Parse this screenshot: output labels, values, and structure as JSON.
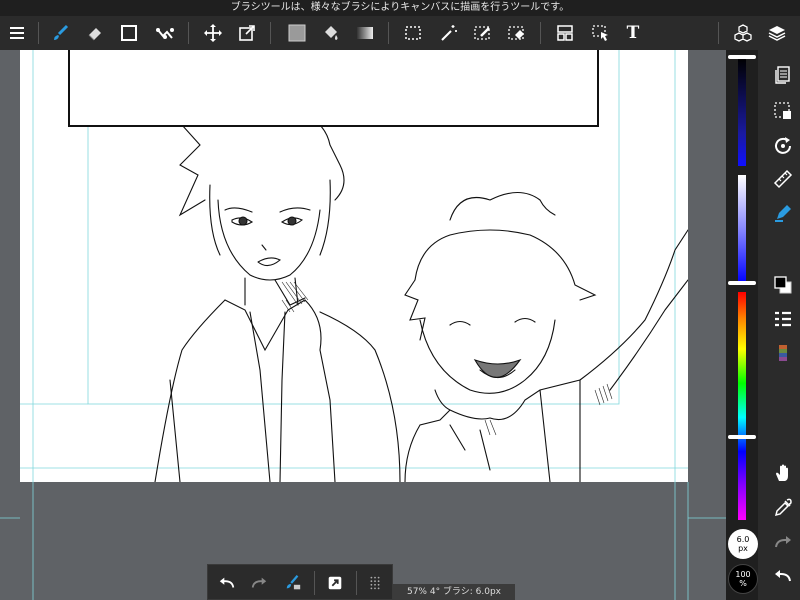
{
  "tooltip": "ブラシツールは、様々なブラシによりキャンバスに描画を行うツールです。",
  "toolbar": {
    "menu_icon": "menu-icon",
    "tools": [
      "brush-icon",
      "eraser-icon",
      "rect-shape-icon",
      "stroke-correction-icon",
      "move-icon",
      "transform-icon",
      "fill-color-icon",
      "bucket-icon",
      "gradient-icon",
      "select-rect-icon",
      "magic-wand-icon",
      "select-pen-icon",
      "select-eraser-icon",
      "layout-icon",
      "select-object-icon",
      "text-icon"
    ],
    "text_tool_label": "T",
    "right_icons": [
      "material-icon",
      "layers-icon"
    ]
  },
  "side_panel": {
    "icons": [
      "pages-icon",
      "select-area-icon",
      "rotate-icon",
      "ruler-icon",
      "pen-fill-icon",
      "color-swatch-icon",
      "list-icon",
      "palette-icon",
      "hand-icon",
      "eyedropper-icon",
      "redo-icon",
      "undo-icon"
    ],
    "brush_size_value": "6.0",
    "brush_size_unit": "px",
    "opacity_value": "100",
    "opacity_unit": "%",
    "colors": {
      "accent": "#2a8ad4",
      "fg_color": "#000000",
      "bg_color": "#ffffff"
    }
  },
  "bottom_bar": {
    "items": [
      "undo-icon",
      "redo-icon",
      "brush-eraser-toggle-icon",
      "snap-icon",
      "grid-dots-icon"
    ]
  },
  "status_text": "57% 4° ブラシ: 6.0px 100%"
}
